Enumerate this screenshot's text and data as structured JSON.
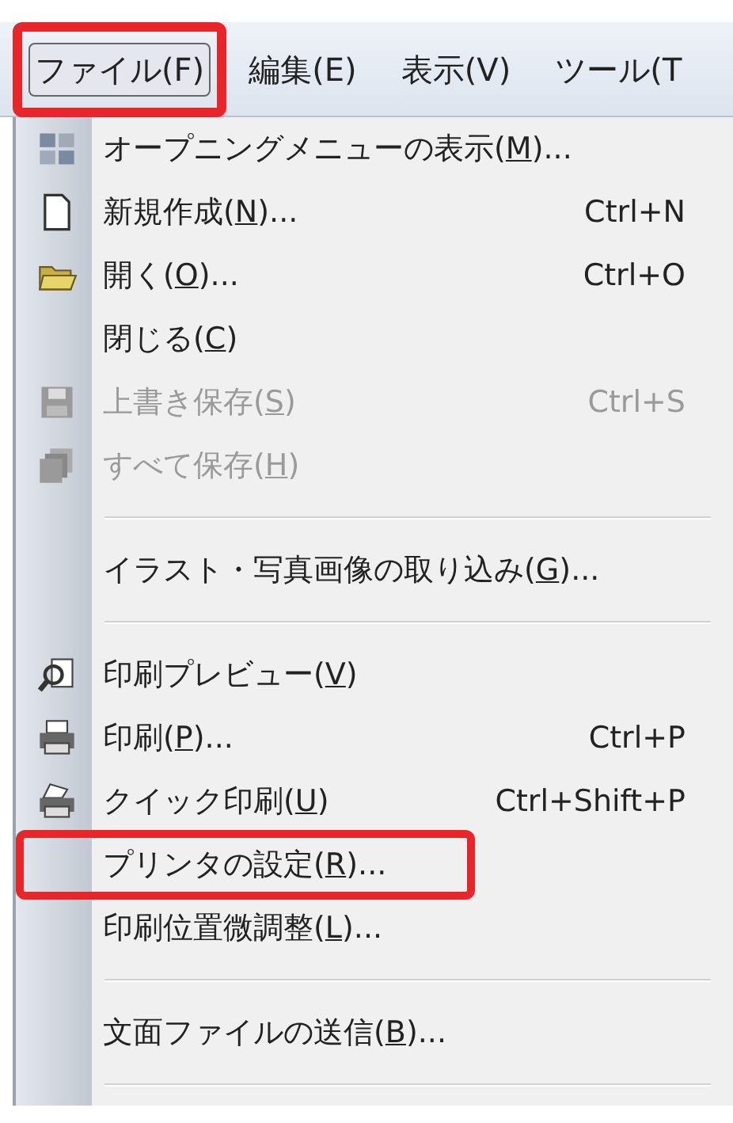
{
  "menu_bar": [
    {
      "label": "ファイル(F)",
      "selected": true,
      "highlighted": true
    },
    {
      "label": "編集(E)",
      "selected": false,
      "highlighted": false
    },
    {
      "label": "表示(V)",
      "selected": false,
      "highlighted": false
    },
    {
      "label": "ツール(T",
      "selected": false,
      "highlighted": false
    }
  ],
  "file_menu": [
    {
      "kind": "item",
      "label": "オープニングメニューの表示(",
      "access_key": "M",
      "label_end": ")...",
      "disabled": false,
      "highlighted": false
    },
    {
      "kind": "item",
      "label": "新規作成(",
      "access_key": "N",
      "label_end": ")...",
      "shortcut": "Ctrl+N",
      "disabled": false,
      "highlighted": false
    },
    {
      "kind": "item",
      "label": "開く(",
      "access_key": "O",
      "label_end": ")...",
      "shortcut": "Ctrl+O",
      "disabled": false,
      "highlighted": false
    },
    {
      "kind": "item",
      "label": "閉じる(",
      "access_key": "C",
      "label_end": ")",
      "disabled": false,
      "highlighted": false
    },
    {
      "kind": "item",
      "label": "上書き保存(",
      "access_key": "S",
      "label_end": ")",
      "shortcut": "Ctrl+S",
      "disabled": true,
      "highlighted": false
    },
    {
      "kind": "item",
      "label": "すべて保存(",
      "access_key": "H",
      "label_end": ")",
      "disabled": true,
      "highlighted": false
    },
    {
      "kind": "separator"
    },
    {
      "kind": "item",
      "label": "イラスト・写真画像の取り込み(",
      "access_key": "G",
      "label_end": ")...",
      "disabled": false,
      "highlighted": false
    },
    {
      "kind": "separator"
    },
    {
      "kind": "item",
      "label": "印刷プレビュー(",
      "access_key": "V",
      "label_end": ")",
      "disabled": false,
      "highlighted": false
    },
    {
      "kind": "item",
      "label": "印刷(",
      "access_key": "P",
      "label_end": ")...",
      "shortcut": "Ctrl+P",
      "disabled": false,
      "highlighted": false
    },
    {
      "kind": "item",
      "label": "クイック印刷(",
      "access_key": "U",
      "label_end": ")",
      "shortcut": "Ctrl+Shift+P",
      "disabled": false,
      "highlighted": false
    },
    {
      "kind": "item",
      "label": "プリンタの設定(",
      "access_key": "R",
      "label_end": ")...",
      "disabled": false,
      "highlighted": true
    },
    {
      "kind": "item",
      "label": "印刷位置微調整(",
      "access_key": "L",
      "label_end": ")...",
      "disabled": false,
      "highlighted": false
    },
    {
      "kind": "separator"
    },
    {
      "kind": "item",
      "label": "文面ファイルの送信(",
      "access_key": "B",
      "label_end": ")...",
      "disabled": false,
      "highlighted": false
    },
    {
      "kind": "separator"
    }
  ]
}
